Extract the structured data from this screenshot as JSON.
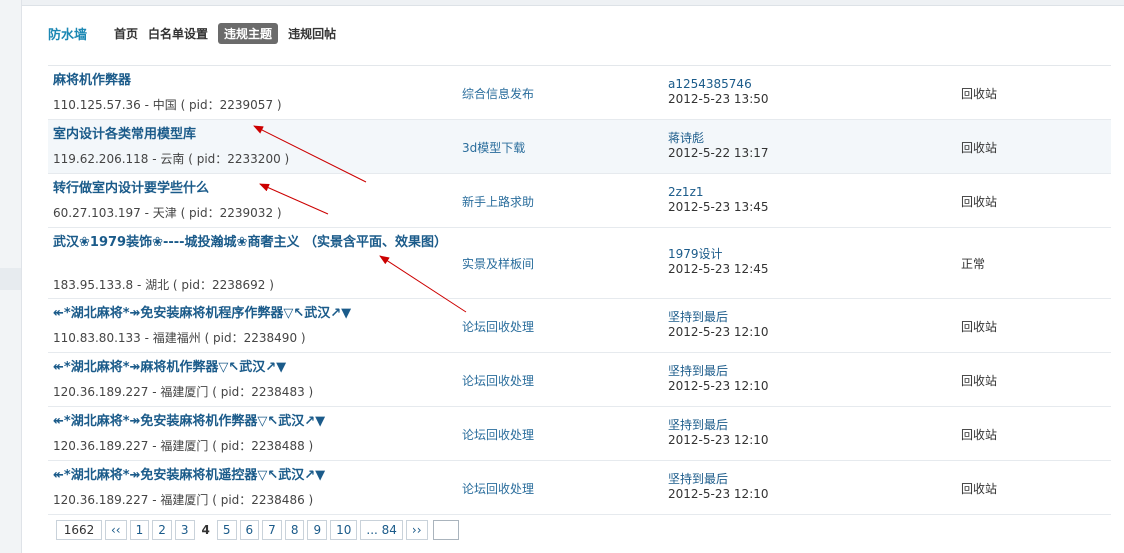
{
  "header": {
    "brand": "防水墙",
    "nav": [
      "首页",
      "白名单设置",
      "违规主题",
      "违规回帖"
    ],
    "active_index": 2
  },
  "rows": [
    {
      "title": "麻将机作弊器",
      "meta": "110.125.57.36 - 中国 ( pid：2239057 )",
      "forum": "综合信息发布",
      "user": "a1254385746",
      "time": "2012-5-23 13:50",
      "status": "回收站"
    },
    {
      "title": "室内设计各类常用模型库",
      "meta": "119.62.206.118 - 云南 ( pid：2233200 )",
      "forum": "3d模型下载",
      "user": "蒋诗彪",
      "time": "2012-5-22 13:17",
      "status": "回收站"
    },
    {
      "title": "转行做室内设计要学些什么",
      "meta": "60.27.103.197 - 天津 ( pid：2239032 )",
      "forum": "新手上路求助",
      "user": "2z1z1",
      "time": "2012-5-23 13:45",
      "status": "回收站"
    },
    {
      "title": "武汉❀1979装饰❀----城投瀚城❀商奢主义 （实景含平面、效果图）",
      "meta": "183.95.133.8 - 湖北 ( pid：2238692 )",
      "forum": "实景及样板间",
      "user": "1979设计",
      "time": "2012-5-23 12:45",
      "status": "正常"
    },
    {
      "title": "↞*湖北麻将*↠免安装麻将机程序作弊器▽↖武汉↗▼",
      "meta": "110.83.80.133 - 福建福州 ( pid：2238490 )",
      "forum": "论坛回收处理",
      "user": "坚持到最后",
      "time": "2012-5-23 12:10",
      "status": "回收站"
    },
    {
      "title": "↞*湖北麻将*↠麻将机作弊器▽↖武汉↗▼",
      "meta": "120.36.189.227 - 福建厦门 ( pid：2238483 )",
      "forum": "论坛回收处理",
      "user": "坚持到最后",
      "time": "2012-5-23 12:10",
      "status": "回收站"
    },
    {
      "title": "↞*湖北麻将*↠免安装麻将机作弊器▽↖武汉↗▼",
      "meta": "120.36.189.227 - 福建厦门 ( pid：2238488 )",
      "forum": "论坛回收处理",
      "user": "坚持到最后",
      "time": "2012-5-23 12:10",
      "status": "回收站"
    },
    {
      "title": "↞*湖北麻将*↠免安装麻将机遥控器▽↖武汉↗▼",
      "meta": "120.36.189.227 - 福建厦门 ( pid：2238486 )",
      "forum": "论坛回收处理",
      "user": "坚持到最后",
      "time": "2012-5-23 12:10",
      "status": "回收站"
    }
  ],
  "pager": {
    "total": "1662",
    "prev": "‹‹",
    "pages": [
      "1",
      "2",
      "3",
      "4",
      "5",
      "6",
      "7",
      "8",
      "9",
      "10",
      "... 84"
    ],
    "current": "4",
    "next": "››"
  },
  "annotation_color": "#cc0000"
}
